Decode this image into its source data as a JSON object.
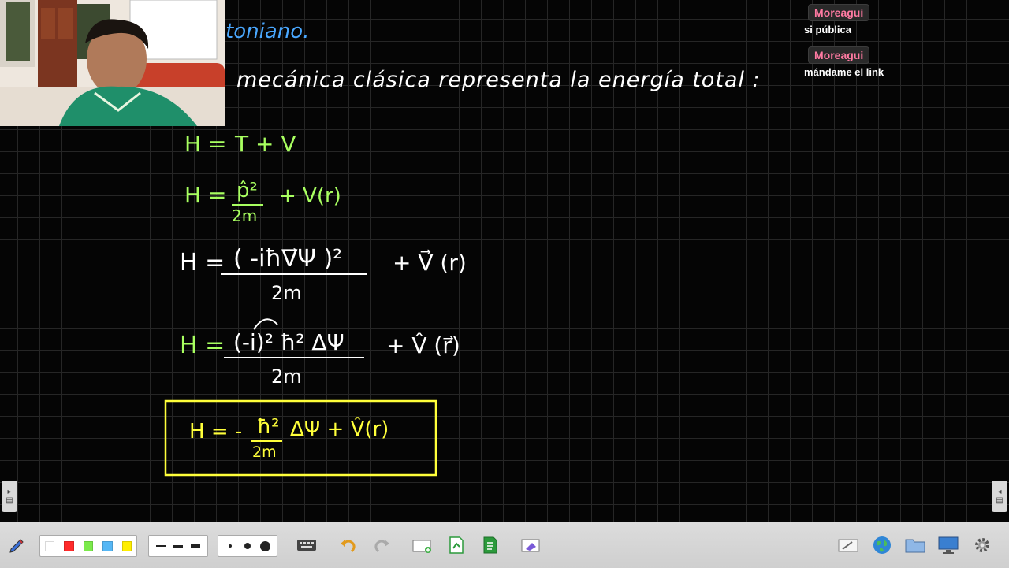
{
  "board": {
    "title_fragment": "toniano.",
    "intro_line": "mecánica clásica representa la energía total :",
    "equations": {
      "eq1": {
        "lhs": "H =",
        "rhs": "T  +  V"
      },
      "eq2": {
        "lhs": "H =",
        "num": "p̂²",
        "den": "2m",
        "tail": "+ V(r)"
      },
      "eq3": {
        "lhs": "H =",
        "num": "( -iħ∇⃗Ψ )²",
        "den": "2m",
        "tail": "+ V⃗ (r)"
      },
      "eq4": {
        "lhs": "H =",
        "num": "(-i)² ħ² ΔΨ",
        "den": "2m",
        "tail": "+ V̂ (r⃗)"
      },
      "eq5": {
        "lhs": "H = -",
        "num": "ħ²",
        "den": "2m",
        "tail": "ΔΨ + V̂(r)"
      }
    }
  },
  "chat": [
    {
      "name": "Moreagui",
      "message": "si pública"
    },
    {
      "name": "Moreagui",
      "message": "mándame el link"
    }
  ],
  "colors": {
    "ink_white": "#ffffff",
    "ink_green": "#a8ff60",
    "ink_yellow": "#ffff3a",
    "ink_blue": "#4aa8ff",
    "chat_name": "#ff7aa2"
  },
  "toolbar": {
    "pen_colors": [
      "#ffffff",
      "#ff2a2a",
      "#7bea4b",
      "#56b7f5",
      "#ffee00"
    ],
    "tools": [
      "pen-tool",
      "color-palette",
      "line-widths",
      "dot-sizes",
      "keyboard",
      "undo",
      "redo",
      "new-page",
      "add-page",
      "page-list",
      "clear",
      "eraser",
      "web",
      "folder",
      "screen",
      "settings"
    ]
  }
}
